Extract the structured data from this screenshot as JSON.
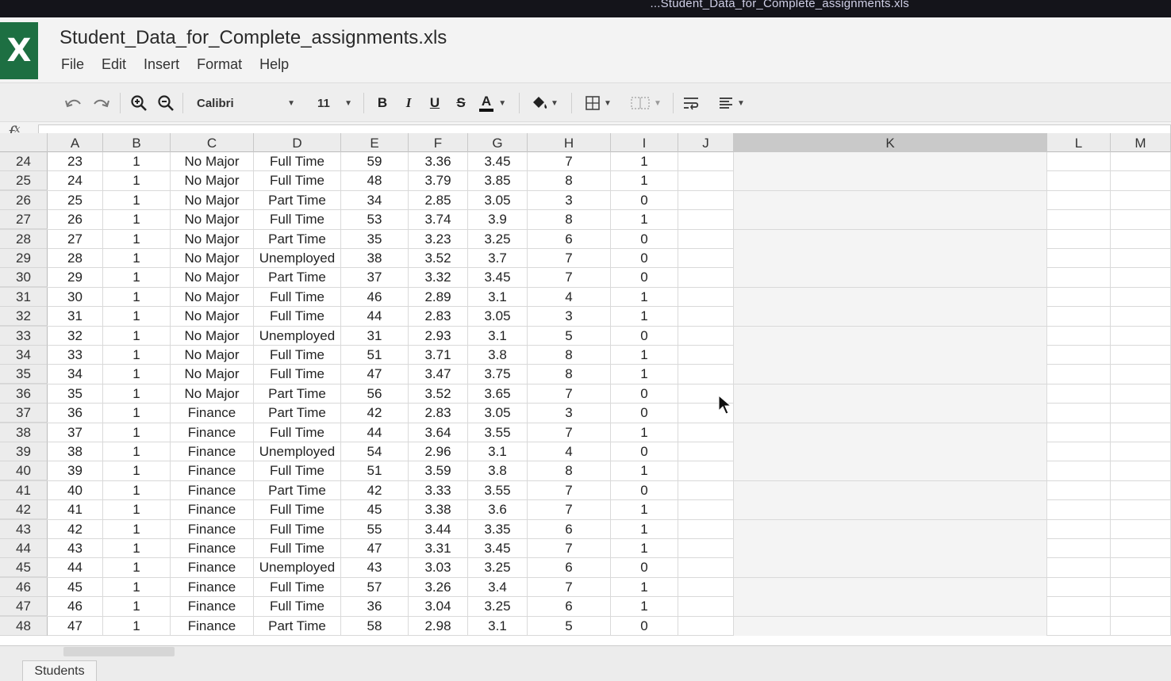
{
  "window": {
    "path_fragment": "...Student_Data_for_Complete_assignments.xls",
    "title": "Student_Data_for_Complete_assignments.xls",
    "app_logo": "X"
  },
  "menu": [
    "File",
    "Edit",
    "Insert",
    "Format",
    "Help"
  ],
  "toolbar": {
    "font": "Calibri",
    "size": "11",
    "bold": "B",
    "italic": "I",
    "underline": "U",
    "strike": "S",
    "font_color": "A",
    "icons": [
      "undo-icon",
      "redo-icon",
      "zoom-in-icon",
      "zoom-out-icon",
      "fill-color-icon",
      "borders-icon",
      "merge-cells-icon",
      "wrap-text-icon",
      "align-icon"
    ]
  },
  "formula_bar": {
    "fx": "f",
    "fx_sup": "x",
    "value": ""
  },
  "columns": [
    "A",
    "B",
    "C",
    "D",
    "E",
    "F",
    "G",
    "H",
    "I",
    "J",
    "K",
    "L",
    "M"
  ],
  "selected_column": "K",
  "rows": [
    {
      "n": "24",
      "c": [
        "23",
        "1",
        "No Major",
        "Full Time",
        "59",
        "3.36",
        "3.45",
        "7",
        "1"
      ]
    },
    {
      "n": "25",
      "c": [
        "24",
        "1",
        "No Major",
        "Full Time",
        "48",
        "3.79",
        "3.85",
        "8",
        "1"
      ]
    },
    {
      "n": "26",
      "c": [
        "25",
        "1",
        "No Major",
        "Part Time",
        "34",
        "2.85",
        "3.05",
        "3",
        "0"
      ]
    },
    {
      "n": "27",
      "c": [
        "26",
        "1",
        "No Major",
        "Full Time",
        "53",
        "3.74",
        "3.9",
        "8",
        "1"
      ]
    },
    {
      "n": "28",
      "c": [
        "27",
        "1",
        "No Major",
        "Part Time",
        "35",
        "3.23",
        "3.25",
        "6",
        "0"
      ]
    },
    {
      "n": "29",
      "c": [
        "28",
        "1",
        "No Major",
        "Unemployed",
        "38",
        "3.52",
        "3.7",
        "7",
        "0"
      ]
    },
    {
      "n": "30",
      "c": [
        "29",
        "1",
        "No Major",
        "Part Time",
        "37",
        "3.32",
        "3.45",
        "7",
        "0"
      ]
    },
    {
      "n": "31",
      "c": [
        "30",
        "1",
        "No Major",
        "Full Time",
        "46",
        "2.89",
        "3.1",
        "4",
        "1"
      ]
    },
    {
      "n": "32",
      "c": [
        "31",
        "1",
        "No Major",
        "Full Time",
        "44",
        "2.83",
        "3.05",
        "3",
        "1"
      ]
    },
    {
      "n": "33",
      "c": [
        "32",
        "1",
        "No Major",
        "Unemployed",
        "31",
        "2.93",
        "3.1",
        "5",
        "0"
      ]
    },
    {
      "n": "34",
      "c": [
        "33",
        "1",
        "No Major",
        "Full Time",
        "51",
        "3.71",
        "3.8",
        "8",
        "1"
      ]
    },
    {
      "n": "35",
      "c": [
        "34",
        "1",
        "No Major",
        "Full Time",
        "47",
        "3.47",
        "3.75",
        "8",
        "1"
      ]
    },
    {
      "n": "36",
      "c": [
        "35",
        "1",
        "No Major",
        "Part Time",
        "56",
        "3.52",
        "3.65",
        "7",
        "0"
      ]
    },
    {
      "n": "37",
      "c": [
        "36",
        "1",
        "Finance",
        "Part Time",
        "42",
        "2.83",
        "3.05",
        "3",
        "0"
      ]
    },
    {
      "n": "38",
      "c": [
        "37",
        "1",
        "Finance",
        "Full Time",
        "44",
        "3.64",
        "3.55",
        "7",
        "1"
      ]
    },
    {
      "n": "39",
      "c": [
        "38",
        "1",
        "Finance",
        "Unemployed",
        "54",
        "2.96",
        "3.1",
        "4",
        "0"
      ]
    },
    {
      "n": "40",
      "c": [
        "39",
        "1",
        "Finance",
        "Full Time",
        "51",
        "3.59",
        "3.8",
        "8",
        "1"
      ]
    },
    {
      "n": "41",
      "c": [
        "40",
        "1",
        "Finance",
        "Part Time",
        "42",
        "3.33",
        "3.55",
        "7",
        "0"
      ]
    },
    {
      "n": "42",
      "c": [
        "41",
        "1",
        "Finance",
        "Full Time",
        "45",
        "3.38",
        "3.6",
        "7",
        "1"
      ]
    },
    {
      "n": "43",
      "c": [
        "42",
        "1",
        "Finance",
        "Full Time",
        "55",
        "3.44",
        "3.35",
        "6",
        "1"
      ]
    },
    {
      "n": "44",
      "c": [
        "43",
        "1",
        "Finance",
        "Full Time",
        "47",
        "3.31",
        "3.45",
        "7",
        "1"
      ]
    },
    {
      "n": "45",
      "c": [
        "44",
        "1",
        "Finance",
        "Unemployed",
        "43",
        "3.03",
        "3.25",
        "6",
        "0"
      ]
    },
    {
      "n": "46",
      "c": [
        "45",
        "1",
        "Finance",
        "Full Time",
        "57",
        "3.26",
        "3.4",
        "7",
        "1"
      ]
    },
    {
      "n": "47",
      "c": [
        "46",
        "1",
        "Finance",
        "Full Time",
        "36",
        "3.04",
        "3.25",
        "6",
        "1"
      ]
    },
    {
      "n": "48",
      "c": [
        "47",
        "1",
        "Finance",
        "Part Time",
        "58",
        "2.98",
        "3.1",
        "5",
        "0"
      ]
    }
  ],
  "sheet_tabs": [
    "Students"
  ],
  "colors": {
    "logo_bg": "#1d6f42",
    "selected_col": "#c9c9c9",
    "header_bg": "#ececec"
  }
}
